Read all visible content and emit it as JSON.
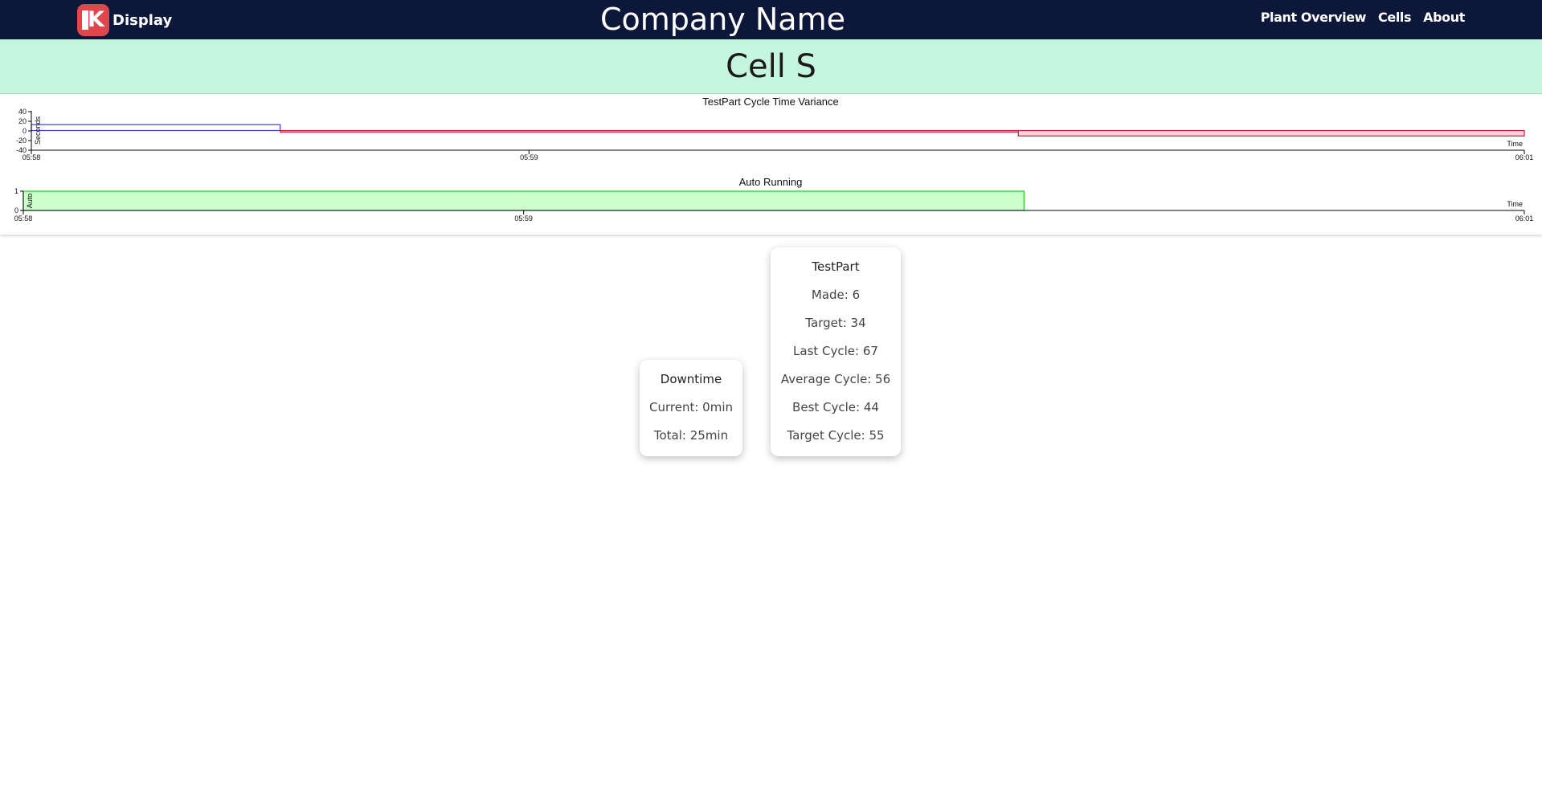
{
  "nav": {
    "logo_glyph": "K",
    "logo_text": "Display",
    "brand": "Company Name",
    "links": [
      "Plant Overview",
      "Cells",
      "About"
    ]
  },
  "cell": {
    "title": "Cell S"
  },
  "colors": {
    "navbar": "#0d173a",
    "header": "#c5f5dc",
    "logo": "#e0474c",
    "positive_series": "#3b3bdd",
    "negative_series": "#d01a3c",
    "negative_fill": "#f9d4dc",
    "auto_fill": "#ccffcc",
    "auto_stroke": "#22cc22"
  },
  "chart_data": [
    {
      "type": "area",
      "title": "TestPart Cycle Time Variance",
      "ylabel": "Seconds",
      "xlabel": "Time",
      "yticks": [
        "40",
        "20",
        "0",
        "-20",
        "-40"
      ],
      "ylim": [
        -40,
        40
      ],
      "xticks": [
        "05:58",
        "05:59",
        "06:01"
      ],
      "x": [
        "05:58:00",
        "05:58:30",
        "05:59:59",
        "06:01:00"
      ],
      "steps": [
        {
          "from": "05:58:00",
          "to": "05:58:30",
          "value": 12
        },
        {
          "from": "05:58:30",
          "to": "05:59:59",
          "value": -3
        },
        {
          "from": "05:59:59",
          "to": "06:01:00",
          "value": -11
        }
      ],
      "grid": false
    },
    {
      "type": "area",
      "title": "Auto Running",
      "ylabel": "Auto",
      "xlabel": "Time",
      "yticks": [
        "1",
        "0"
      ],
      "ylim": [
        0,
        1
      ],
      "xticks": [
        "05:58",
        "05:59",
        "06:01"
      ],
      "steps": [
        {
          "from": "05:58:00",
          "to": "06:00:00",
          "value": 1
        },
        {
          "from": "06:00:00",
          "to": "06:01:00",
          "value": 0
        }
      ],
      "grid": false
    }
  ],
  "downtime": {
    "title": "Downtime",
    "current": "Current: 0min",
    "total": "Total: 25min"
  },
  "part": {
    "title": "TestPart",
    "made": "Made: 6",
    "target": "Target: 34",
    "last_cycle": "Last Cycle: 67",
    "average_cycle": "Average Cycle: 56",
    "best_cycle": "Best Cycle: 44",
    "target_cycle": "Target Cycle: 55"
  }
}
